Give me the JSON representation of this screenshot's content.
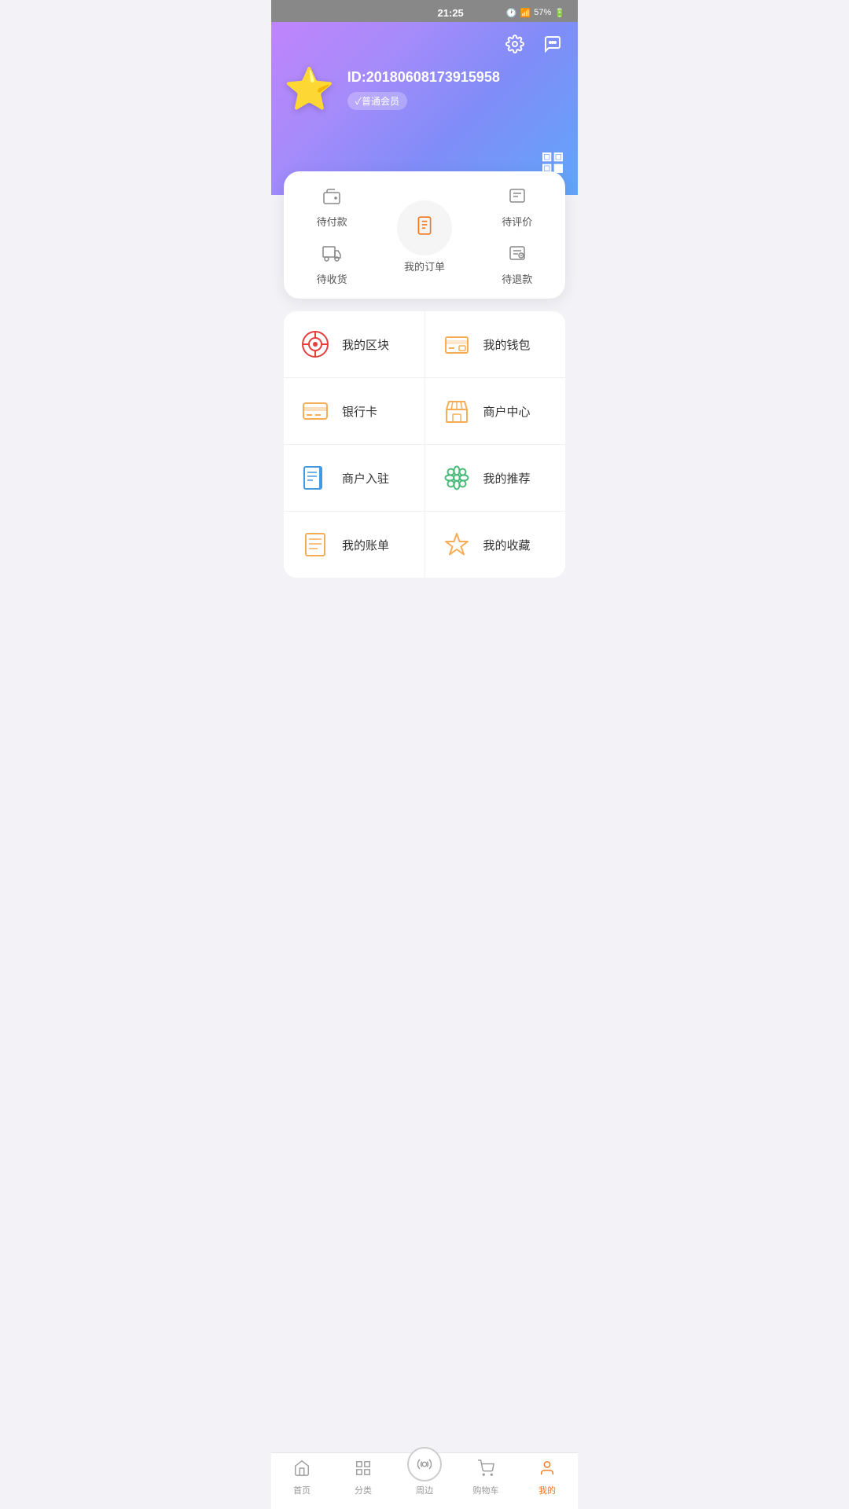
{
  "statusBar": {
    "time": "21:25",
    "battery": "57%"
  },
  "header": {
    "userId": "ID:20180608173915958",
    "memberBadge": "✓普通会员",
    "settingsIcon": "⚙",
    "messageIcon": "💬",
    "qrIcon": "▦"
  },
  "orderCard": {
    "centerLabel": "我的订单",
    "items": [
      {
        "id": "pending-payment",
        "icon": "wallet",
        "label": "待付款"
      },
      {
        "id": "pending-receipt",
        "icon": "truck",
        "label": "待收货"
      },
      {
        "id": "pending-review",
        "icon": "review",
        "label": "待评价"
      },
      {
        "id": "pending-refund",
        "icon": "refund",
        "label": "待退款"
      }
    ]
  },
  "menuItems": [
    [
      {
        "id": "my-block",
        "label": "我的区块",
        "icon": "block",
        "color": "#e53e3e"
      },
      {
        "id": "my-wallet",
        "label": "我的钱包",
        "icon": "wallet2",
        "color": "#f6ad55"
      }
    ],
    [
      {
        "id": "bank-card",
        "label": "银行卡",
        "icon": "card",
        "color": "#f6ad55"
      },
      {
        "id": "merchant-center",
        "label": "商户中心",
        "icon": "store",
        "color": "#f6ad55"
      }
    ],
    [
      {
        "id": "merchant-join",
        "label": "商户入驻",
        "icon": "doc",
        "color": "#4299e1"
      },
      {
        "id": "my-recommend",
        "label": "我的推荐",
        "icon": "flower",
        "color": "#48bb78"
      }
    ],
    [
      {
        "id": "my-bill",
        "label": "我的账单",
        "icon": "bill",
        "color": "#f6ad55"
      },
      {
        "id": "my-favorites",
        "label": "我的收藏",
        "icon": "star2",
        "color": "#f6ad55"
      }
    ]
  ],
  "bottomNav": [
    {
      "id": "home",
      "label": "首页",
      "icon": "home",
      "active": false
    },
    {
      "id": "category",
      "label": "分类",
      "icon": "grid",
      "active": false
    },
    {
      "id": "nearby",
      "label": "周边",
      "icon": "signal",
      "active": false,
      "center": true
    },
    {
      "id": "cart",
      "label": "购物车",
      "icon": "cart",
      "active": false
    },
    {
      "id": "mine",
      "label": "我的",
      "icon": "user",
      "active": true
    }
  ]
}
